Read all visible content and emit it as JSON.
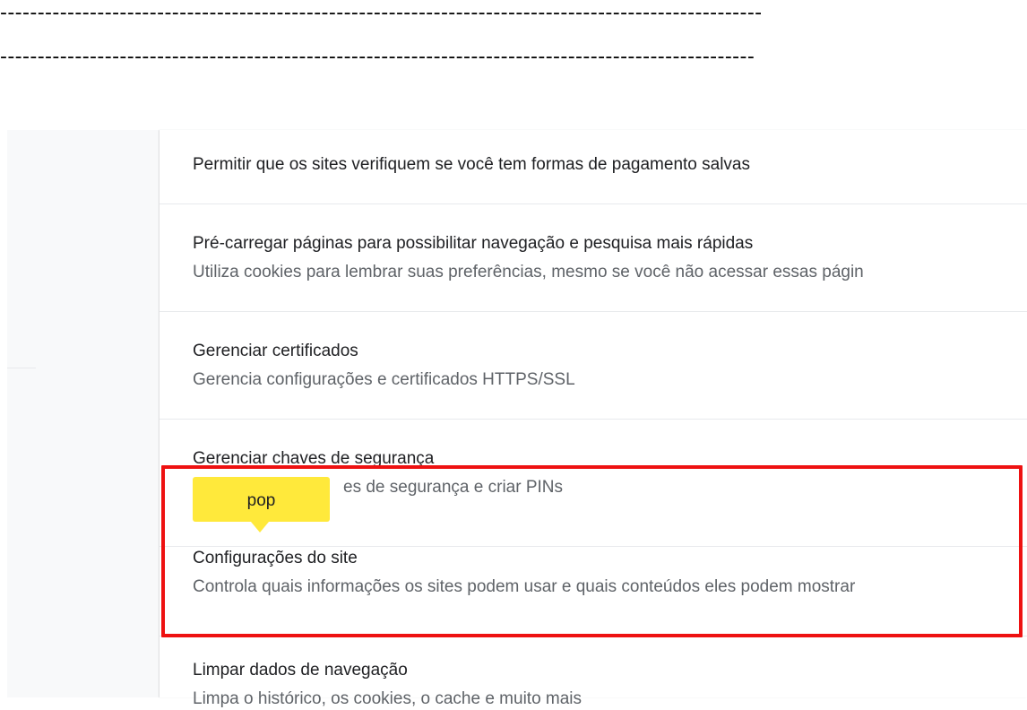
{
  "annotations": {
    "dashes_top": "------------------------------------------------------------------------------------------------------",
    "dashes_bottom": "-----------------------------------------------------------------------------------------------------",
    "tooltip_label": "pop",
    "tooltip_color": "#ffe93b",
    "highlight_color": "#ee1111"
  },
  "settings": {
    "rows": [
      {
        "title": "Permitir que os sites verifiquem se você tem formas de pagamento salvas"
      },
      {
        "title": "Pré-carregar páginas para possibilitar navegação e pesquisa mais rápidas",
        "subtitle": "Utiliza cookies para lembrar suas preferências, mesmo se você não acessar essas págin"
      },
      {
        "title": "Gerenciar certificados",
        "subtitle": "Gerencia configurações e certificados HTTPS/SSL"
      },
      {
        "title": "Gerenciar chaves de segurança",
        "subtitle_visible": "es de segurança e criar PINs"
      },
      {
        "title": "Configurações do site",
        "subtitle": "Controla quais informações os sites podem usar e quais conteúdos eles podem mostrar"
      },
      {
        "title": "Limpar dados de navegação",
        "subtitle": "Limpa o histórico, os cookies, o cache e muito mais"
      }
    ]
  }
}
